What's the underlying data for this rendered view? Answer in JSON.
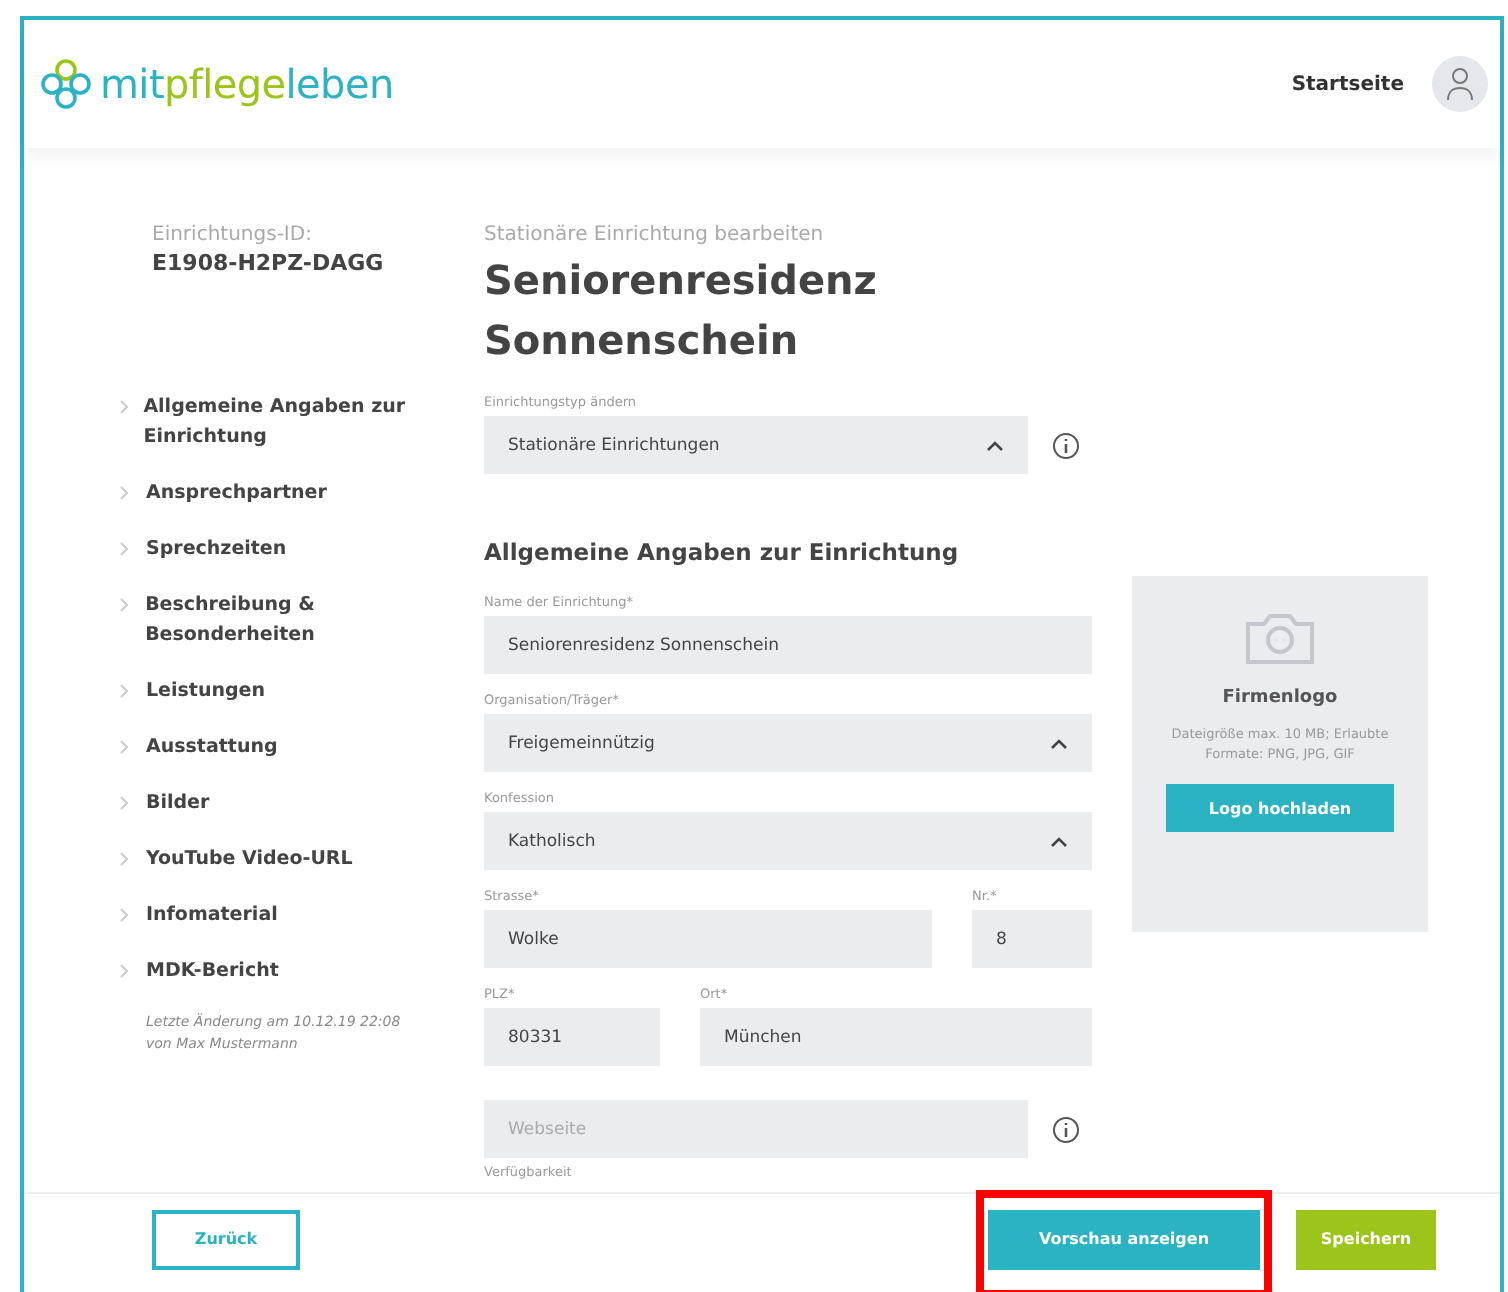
{
  "header": {
    "logo": [
      {
        "text": "mit",
        "color": "#2bb3c3"
      },
      {
        "text": "pflege",
        "color": "#9dc41a"
      },
      {
        "text": "leben",
        "color": "#2bb3c3"
      }
    ],
    "nav_link": "Startseite"
  },
  "sidebar": {
    "id_label": "Einrichtungs-ID:",
    "id_value": "E1908-H2PZ-DAGG",
    "items": [
      {
        "label": "Allgemeine Angaben zur Einrichtung"
      },
      {
        "label": "Ansprechpartner"
      },
      {
        "label": "Sprechzeiten"
      },
      {
        "label": "Beschreibung & Besonderheiten"
      },
      {
        "label": "Leistungen"
      },
      {
        "label": "Ausstattung"
      },
      {
        "label": "Bilder"
      },
      {
        "label": "YouTube Video-URL"
      },
      {
        "label": "Infomaterial"
      },
      {
        "label": "MDK-Bericht"
      }
    ],
    "last_change": "Letzte Änderung am 10.12.19 22:08 von Max Mustermann"
  },
  "form": {
    "subtitle": "Stationäre Einrichtung bearbeiten",
    "title": "Seniorenresidenz Sonnenschein",
    "type_field": {
      "label": "Einrichtungstyp ändern",
      "value": "Stationäre Einrichtungen",
      "kind": "select",
      "info": true
    },
    "section_title": "Allgemeine Angaben zur Einrichtung",
    "rows": [
      {
        "fields": [
          {
            "label": "Name der Einrichtung*",
            "value": "Seniorenresidenz Sonnenschein",
            "kind": "text"
          }
        ]
      },
      {
        "fields": [
          {
            "label": "Organisation/Träger*",
            "value": "Freigemeinnützig",
            "kind": "select"
          }
        ]
      },
      {
        "fields": [
          {
            "label": "Konfession",
            "value": "Katholisch",
            "kind": "select"
          }
        ]
      },
      {
        "fields": [
          {
            "label": "Strasse*",
            "value": "Wolke",
            "kind": "text"
          },
          {
            "label": "Nr.*",
            "value": "8",
            "kind": "number"
          }
        ]
      },
      {
        "fields": [
          {
            "label": "PLZ*",
            "value": "80331",
            "kind": "number"
          },
          {
            "label": "Ort*",
            "value": "München",
            "kind": "text"
          }
        ]
      }
    ],
    "website_field": {
      "placeholder": "Webseite",
      "kind": "text",
      "info": true
    },
    "next_label": "Verfügbarkeit"
  },
  "logo_card": {
    "title": "Firmenlogo",
    "hint": "Dateigröße max. 10 MB; Erlaubte Formate: PNG, JPG, GIF",
    "button": "Logo hochladen"
  },
  "footer": {
    "back": "Zurück",
    "preview": "Vorschau anzeigen",
    "save": "Speichern",
    "preview_highlighted": true
  }
}
